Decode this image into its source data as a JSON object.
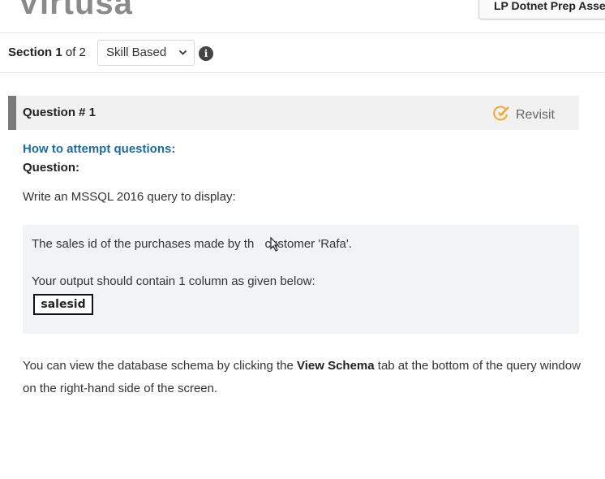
{
  "header": {
    "logo_text": "Virtusa",
    "assessment_title": "LP Dotnet Prep Assessment"
  },
  "section": {
    "label": "Section",
    "current": "1",
    "of_text": "of 2",
    "selected": "Skill Based"
  },
  "question": {
    "number_label": "Question # 1",
    "revisit_label": "Revisit",
    "how_to": "How to attempt questions:",
    "question_label": "Question:",
    "instruction": "Write an MSSQL 2016 query to display:",
    "detail_part1": "The sales id of the purchases made by th",
    "detail_part2": " customer 'Rafa'.",
    "output_note": "Your output should contain 1 column as given below:",
    "output_column": "salesid",
    "schema_before": "You can view the database schema by clicking the ",
    "schema_bold": "View Schema",
    "schema_after": " tab at the bottom of the query window on the right-hand side of the screen."
  },
  "colors": {
    "link_blue": "#1c6d9c",
    "revisit_orange": "#f0a830",
    "header_border": "#7a7a7a"
  },
  "icons": {
    "info": "info-icon",
    "revisit": "revisit-edit-icon",
    "chevron": "chevron-down-icon",
    "cursor": "mouse-cursor-icon"
  }
}
